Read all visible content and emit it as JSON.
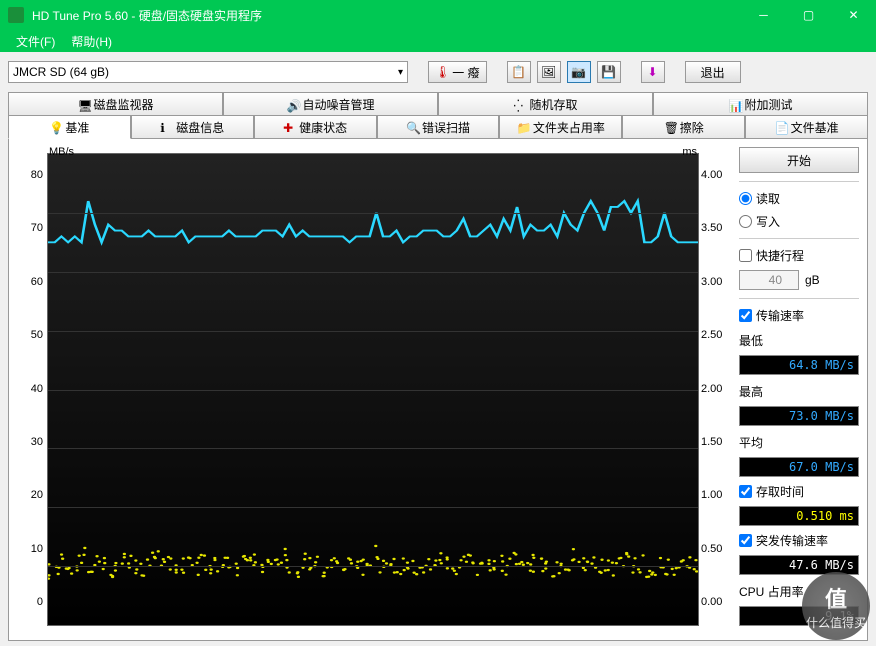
{
  "window": {
    "title": "HD Tune Pro 5.60 - 硬盘/固态硬盘实用程序"
  },
  "menu": {
    "file": "文件(F)",
    "help": "帮助(H)"
  },
  "toolbar": {
    "drive": "JMCR  SD (64 gB)",
    "temp": "一 癈",
    "exit": "退出"
  },
  "tabs_row1": {
    "monitor": "磁盘监视器",
    "aam": "自动噪音管理",
    "random": "随机存取",
    "extra": "附加测试"
  },
  "tabs_row2": {
    "benchmark": "基准",
    "info": "磁盘信息",
    "health": "健康状态",
    "scan": "错误扫描",
    "folder": "文件夹占用率",
    "erase": "擦除",
    "filebench": "文件基准"
  },
  "controls": {
    "start": "开始",
    "read": "读取",
    "write": "写入",
    "short": "快捷行程",
    "short_val": "40",
    "short_unit": "gB",
    "transfer": "传输速率",
    "min_lbl": "最低",
    "min_val": "64.8 MB/s",
    "max_lbl": "最高",
    "max_val": "73.0 MB/s",
    "avg_lbl": "平均",
    "avg_val": "67.0 MB/s",
    "access_lbl": "存取时间",
    "access_val": "0.510 ms",
    "burst_lbl": "突发传输速率",
    "burst_val": "47.6 MB/s",
    "cpu_lbl": "CPU 占用率",
    "cpu_val": "9.1%"
  },
  "chart_data": {
    "type": "line",
    "xlabel": "",
    "ylabel_left": "MB/s",
    "ylabel_right": "ms",
    "ylim_left": [
      0,
      80
    ],
    "ylim_right": [
      0,
      4.0
    ],
    "y_ticks_left": [
      0,
      10,
      20,
      30,
      40,
      50,
      60,
      70,
      80
    ],
    "y_ticks_right": [
      "0.00",
      "0.50",
      "1.00",
      "1.50",
      "2.00",
      "2.50",
      "3.00",
      "3.50",
      "4.00"
    ],
    "series": [
      {
        "name": "transfer_rate",
        "color": "#2ad8ff",
        "values": [
          65,
          65,
          66,
          65,
          66,
          65,
          72,
          68,
          65,
          68,
          67,
          67,
          66,
          66,
          66,
          67,
          66,
          66,
          66,
          66,
          67,
          65,
          66,
          66,
          66,
          66,
          66,
          67,
          66,
          66,
          66,
          66,
          67,
          67,
          67,
          66,
          68,
          66,
          67,
          66,
          66,
          66,
          66,
          66,
          66,
          65,
          66,
          66,
          66,
          70,
          66,
          66,
          67,
          65,
          66,
          66,
          67,
          67,
          67,
          66,
          66,
          67,
          69,
          66,
          66,
          67,
          68,
          66,
          69,
          67,
          71,
          66,
          68,
          67,
          67,
          68,
          66,
          70,
          68,
          67,
          70,
          72,
          70,
          67,
          71,
          71,
          72,
          70,
          72,
          65,
          65,
          66,
          70,
          66,
          65,
          65,
          65,
          65
        ]
      },
      {
        "name": "access_time",
        "color": "#e6e600",
        "values": [
          0.45,
          0.5,
          0.55,
          0.48,
          0.52,
          0.6,
          0.5,
          0.55,
          0.5,
          0.48,
          0.5,
          0.55,
          0.52,
          0.5,
          0.48,
          0.55,
          0.58,
          0.5,
          0.52,
          0.48,
          0.5,
          0.55,
          0.5,
          0.52,
          0.48,
          0.5,
          0.55,
          0.5,
          0.48,
          0.52,
          0.5,
          0.55,
          0.5,
          0.48,
          0.52,
          0.58,
          0.5,
          0.48,
          0.55,
          0.5,
          0.52,
          0.48,
          0.5,
          0.55,
          0.5,
          0.52,
          0.48,
          0.5,
          0.55,
          0.6,
          0.5,
          0.48,
          0.52,
          0.5,
          0.55,
          0.5,
          0.48,
          0.52,
          0.5,
          0.55,
          0.5,
          0.48,
          0.52,
          0.58,
          0.5,
          0.55,
          0.48,
          0.5,
          0.52,
          0.5,
          0.55,
          0.48,
          0.5,
          0.52,
          0.5,
          0.55,
          0.48,
          0.5,
          0.52,
          0.58,
          0.5,
          0.48,
          0.55,
          0.5,
          0.52,
          0.48,
          0.5,
          0.55,
          0.5,
          0.52,
          0.48,
          0.5,
          0.55,
          0.5,
          0.48,
          0.52,
          0.5,
          0.5
        ]
      }
    ]
  },
  "watermark": {
    "line1": "值",
    "line2": "什么值得买"
  }
}
